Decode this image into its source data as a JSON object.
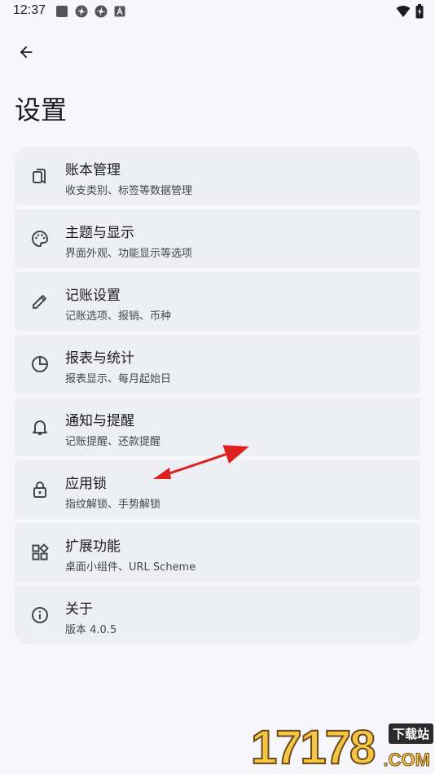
{
  "status_bar": {
    "time": "12:37",
    "left_icons": [
      "square-icon",
      "pinwheel-icon",
      "pinwheel-icon",
      "a-badge-icon"
    ],
    "right_icons": [
      "wifi-icon",
      "battery-icon"
    ]
  },
  "header": {
    "back_icon": "arrow-left-icon",
    "title": "设置"
  },
  "settings": [
    {
      "icon": "ledger-icon",
      "title": "账本管理",
      "subtitle": "收支类别、标签等数据管理"
    },
    {
      "icon": "palette-icon",
      "title": "主题与显示",
      "subtitle": "界面外观、功能显示等选项"
    },
    {
      "icon": "pencil-icon",
      "title": "记账设置",
      "subtitle": "记账选项、报销、币种"
    },
    {
      "icon": "pie-chart-icon",
      "title": "报表与统计",
      "subtitle": "报表显示、每月起始日"
    },
    {
      "icon": "bell-icon",
      "title": "通知与提醒",
      "subtitle": "记账提醒、还款提醒"
    },
    {
      "icon": "lock-icon",
      "title": "应用锁",
      "subtitle": "指纹解锁、手势解锁"
    },
    {
      "icon": "widgets-icon",
      "title": "扩展功能",
      "subtitle": "桌面小组件、URL Scheme"
    },
    {
      "icon": "info-icon",
      "title": "关于",
      "subtitle": "版本 4.0.5"
    }
  ],
  "annotation": {
    "color": "#e02020"
  },
  "watermark": {
    "digits": "17178",
    "badge": "下载站",
    "domain": ".COM"
  },
  "colors": {
    "background": "#f6f6fb",
    "card": "#eeeef5",
    "text": "#1b1b1f",
    "subtext": "#45464f"
  }
}
